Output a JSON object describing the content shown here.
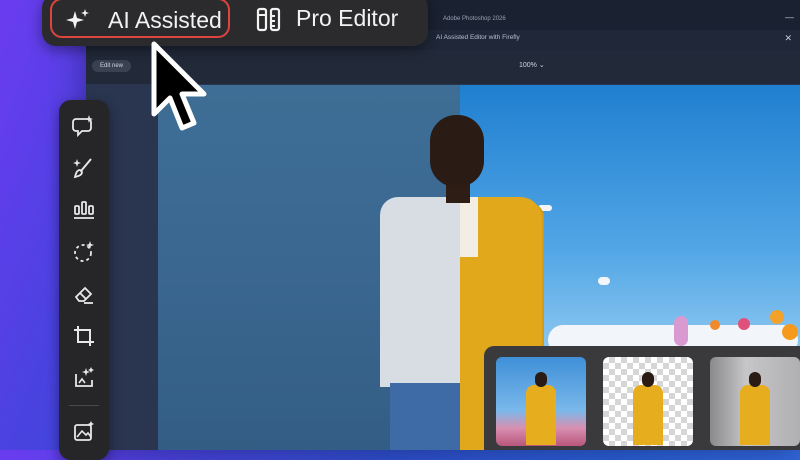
{
  "window": {
    "title": "Adobe Photoshop 2026",
    "subtitle": "AI Assisted Editor with Firefly",
    "edit_new_label": "Edit new",
    "zoom_label": "100%",
    "minimize_glyph": "—",
    "close_glyph": "✕"
  },
  "mode_switch": {
    "ai_label": "AI Assisted",
    "pro_label": "Pro Editor",
    "selected": "AI Assisted",
    "ai_icon": "sparkles-icon",
    "pro_icon": "pencil-ruler-icon",
    "highlight_color": "#e0443f"
  },
  "tool_rail": {
    "tools": [
      {
        "name": "generative-fill-icon"
      },
      {
        "name": "brush-icon"
      },
      {
        "name": "adjustments-icon"
      },
      {
        "name": "select-subject-icon"
      },
      {
        "name": "eraser-icon"
      },
      {
        "name": "crop-icon"
      },
      {
        "name": "generate-image-icon"
      },
      {
        "name": "add-image-icon"
      }
    ]
  },
  "thumbnails": [
    {
      "name": "thumbnail-flowers-background"
    },
    {
      "name": "thumbnail-transparent-background"
    },
    {
      "name": "thumbnail-concrete-background"
    }
  ],
  "colors": {
    "brand_gradient_start": "#6b3cf0",
    "suit": "#e2a81c",
    "wall": "#3a6790",
    "sky": "#52a6e6"
  }
}
